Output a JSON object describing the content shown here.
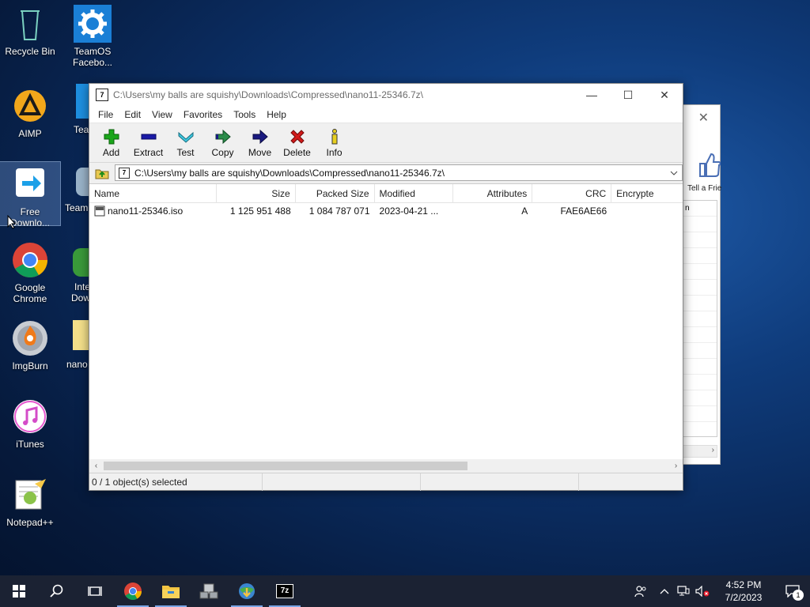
{
  "desktop": {
    "icons": [
      {
        "label": "Recycle Bin",
        "icon": "recycle-bin-icon"
      },
      {
        "label": "TeamOS Facebo...",
        "icon": "gear-icon"
      },
      {
        "label": "AIMP",
        "icon": "aimp-icon"
      },
      {
        "label": "Free Downlo...",
        "icon": "free-download-icon"
      },
      {
        "label": "Google Chrome",
        "icon": "chrome-icon"
      },
      {
        "label": "ImgBurn",
        "icon": "imgburn-icon"
      },
      {
        "label": "iTunes",
        "icon": "itunes-icon"
      },
      {
        "label": "Notepad++",
        "icon": "notepadpp-icon"
      }
    ],
    "partial_icons": [
      "Tea",
      "Team",
      "Inte",
      "Dow",
      "nano"
    ]
  },
  "background_window": {
    "tell_label": "Tell a Frie",
    "panel_text": "n"
  },
  "window": {
    "title": "C:\\Users\\my balls are squishy\\Downloads\\Compressed\\nano11-25346.7z\\",
    "app_icon_text": "7",
    "menu": [
      "File",
      "Edit",
      "View",
      "Favorites",
      "Tools",
      "Help"
    ],
    "toolbar": [
      "Add",
      "Extract",
      "Test",
      "Copy",
      "Move",
      "Delete",
      "Info"
    ],
    "address": "C:\\Users\\my balls are squishy\\Downloads\\Compressed\\nano11-25346.7z\\",
    "columns": [
      "Name",
      "Size",
      "Packed Size",
      "Modified",
      "Attributes",
      "CRC",
      "Encrypte"
    ],
    "rows": [
      {
        "name": "nano11-25346.iso",
        "size": "1 125 951 488",
        "packed": "1 084 787 071",
        "modified": "2023-04-21 ...",
        "attributes": "A",
        "crc": "FAE6AE66",
        "encrypted": ""
      }
    ],
    "status": "0 / 1 object(s) selected"
  },
  "taskbar": {
    "apps": [
      "start-icon",
      "search-icon",
      "task-view-icon",
      "chrome-icon",
      "file-explorer-icon",
      "network-share-icon",
      "internet-download-manager-icon",
      "7zip-icon"
    ],
    "sevenzip_label": "7z",
    "clock_time": "4:52 PM",
    "clock_date": "7/2/2023",
    "notification_count": "1"
  },
  "colors": {
    "add": "#1aa61a",
    "extract": "#1a1aa6",
    "test": "#1aa6c6",
    "copy": "#2a8c4a",
    "move": "#1a1a80",
    "delete": "#d21a1a",
    "info": "#1a1a1a"
  }
}
